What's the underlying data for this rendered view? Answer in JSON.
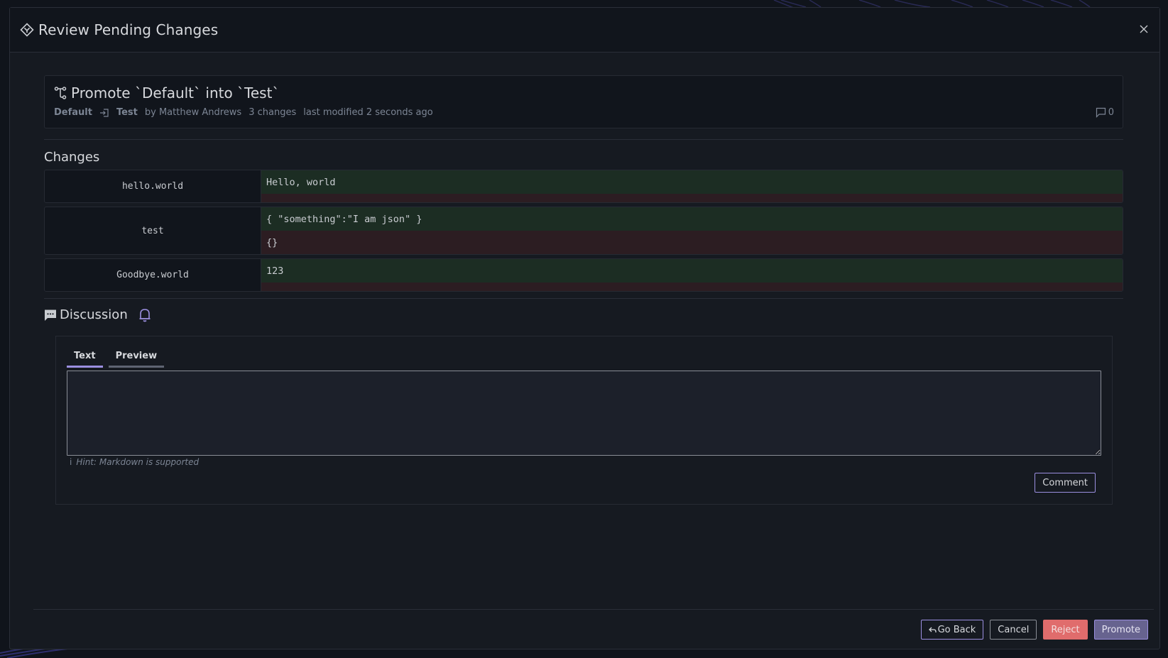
{
  "modal": {
    "title": "Review Pending Changes",
    "close_label": "×"
  },
  "promotion": {
    "title": "Promote `Default` into `Test`",
    "source_branch": "Default",
    "target_branch": "Test",
    "author": "by Matthew Andrews",
    "change_count": "3 changes",
    "last_modified": "last modified 2 seconds ago",
    "comment_count": "0"
  },
  "changes": {
    "heading": "Changes",
    "items": [
      {
        "key": "hello.world",
        "new_value": "Hello, world",
        "old_value": ""
      },
      {
        "key": "test",
        "new_value": "{ \"something\":\"I am json\" }",
        "old_value": "{}"
      },
      {
        "key": "Goodbye.world",
        "new_value": "123",
        "old_value": ""
      }
    ]
  },
  "discussion": {
    "heading": "Discussion",
    "tabs": [
      {
        "label": "Text",
        "active": true
      },
      {
        "label": "Preview",
        "active": false
      }
    ],
    "textarea_value": "",
    "hint_icon": "i",
    "hint": "Hint: Markdown is supported",
    "comment_button": "Comment"
  },
  "footer": {
    "go_back": "Go Back",
    "cancel": "Cancel",
    "reject": "Reject",
    "promote": "Promote"
  },
  "colors": {
    "accent": "#9b8fe0",
    "added_bg": "#1c2d23",
    "removed_bg": "#2c1d22",
    "reject": "#e06c6c",
    "promote": "#67638f"
  }
}
